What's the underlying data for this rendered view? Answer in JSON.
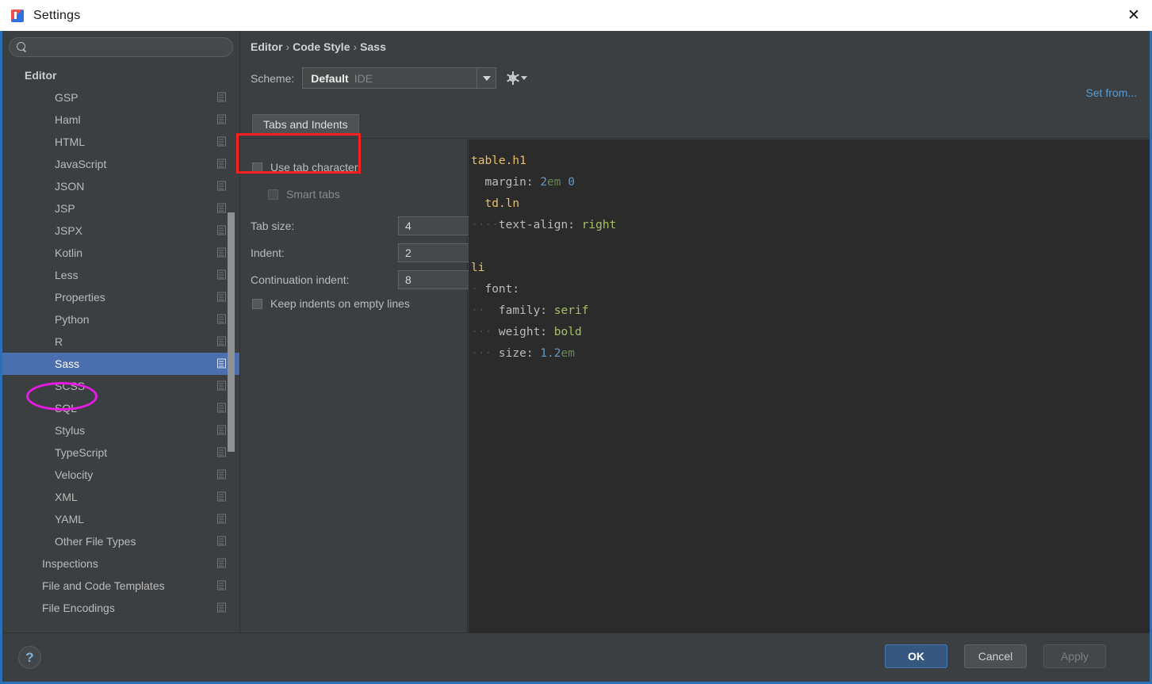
{
  "window": {
    "title": "Settings",
    "app_icon": "intellij-idea-icon",
    "close_label": "✕",
    "accent_border": "#2c6fb5"
  },
  "sidebar": {
    "search": {
      "value": "",
      "placeholder": "",
      "icon": "search-icon"
    },
    "items": [
      {
        "label": "Editor",
        "level": 0,
        "selected": false,
        "icon": false
      },
      {
        "label": "GSP",
        "level": 1,
        "selected": false,
        "icon": true
      },
      {
        "label": "Haml",
        "level": 1,
        "selected": false,
        "icon": true
      },
      {
        "label": "HTML",
        "level": 1,
        "selected": false,
        "icon": true
      },
      {
        "label": "JavaScript",
        "level": 1,
        "selected": false,
        "icon": true
      },
      {
        "label": "JSON",
        "level": 1,
        "selected": false,
        "icon": true
      },
      {
        "label": "JSP",
        "level": 1,
        "selected": false,
        "icon": true
      },
      {
        "label": "JSPX",
        "level": 1,
        "selected": false,
        "icon": true
      },
      {
        "label": "Kotlin",
        "level": 1,
        "selected": false,
        "icon": true
      },
      {
        "label": "Less",
        "level": 1,
        "selected": false,
        "icon": true
      },
      {
        "label": "Properties",
        "level": 1,
        "selected": false,
        "icon": true
      },
      {
        "label": "Python",
        "level": 1,
        "selected": false,
        "icon": true
      },
      {
        "label": "R",
        "level": 1,
        "selected": false,
        "icon": true
      },
      {
        "label": "Sass",
        "level": 1,
        "selected": true,
        "icon": true
      },
      {
        "label": "SCSS",
        "level": 1,
        "selected": false,
        "icon": true
      },
      {
        "label": "SQL",
        "level": 1,
        "selected": false,
        "icon": true
      },
      {
        "label": "Stylus",
        "level": 1,
        "selected": false,
        "icon": true
      },
      {
        "label": "TypeScript",
        "level": 1,
        "selected": false,
        "icon": true
      },
      {
        "label": "Velocity",
        "level": 1,
        "selected": false,
        "icon": true
      },
      {
        "label": "XML",
        "level": 1,
        "selected": false,
        "icon": true
      },
      {
        "label": "YAML",
        "level": 1,
        "selected": false,
        "icon": true
      },
      {
        "label": "Other File Types",
        "level": 1,
        "selected": false,
        "icon": true
      },
      {
        "label": "Inspections",
        "level": 5,
        "selected": false,
        "icon": true
      },
      {
        "label": "File and Code Templates",
        "level": 5,
        "selected": false,
        "icon": true
      },
      {
        "label": "File Encodings",
        "level": 5,
        "selected": false,
        "icon": true
      }
    ]
  },
  "content": {
    "breadcrumb": {
      "parts": [
        "Editor",
        "Code Style",
        "Sass"
      ],
      "separator": "›"
    },
    "scheme": {
      "label": "Scheme:",
      "value": "Default",
      "sub_value": "IDE",
      "dropdown_icon": "chevron-down-icon",
      "gear_icon": "gear-icon"
    },
    "set_from_link": "Set from...",
    "tabs": [
      {
        "label": "Tabs and Indents",
        "active": true
      }
    ],
    "options": {
      "use_tab_character": {
        "label": "Use tab character",
        "checked": false,
        "disabled": false
      },
      "smart_tabs": {
        "label": "Smart tabs",
        "checked": false,
        "disabled": true
      },
      "tab_size": {
        "label": "Tab size:",
        "value": "4"
      },
      "indent": {
        "label": "Indent:",
        "value": "2"
      },
      "continuation_indent": {
        "label": "Continuation indent:",
        "value": "8"
      },
      "keep_indents": {
        "label": "Keep indents on empty lines",
        "checked": false,
        "disabled": false
      }
    },
    "preview": {
      "lines": [
        [
          {
            "t": "table",
            "c": "c-sel"
          },
          {
            "t": ".h1",
            "c": "c-sel"
          }
        ],
        [
          {
            "t": "  ",
            "c": "c-dot"
          },
          {
            "t": "margin: ",
            "c": "c-prop"
          },
          {
            "t": "2",
            "c": "c-num"
          },
          {
            "t": "em ",
            "c": "c-unit"
          },
          {
            "t": "0",
            "c": "c-num"
          }
        ],
        [
          {
            "t": "  ",
            "c": "c-dot"
          },
          {
            "t": "td",
            "c": "c-sel"
          },
          {
            "t": ".ln",
            "c": "c-sel"
          }
        ],
        [
          {
            "t": "····",
            "c": "c-dot"
          },
          {
            "t": "text-align: ",
            "c": "c-prop"
          },
          {
            "t": "right",
            "c": "c-val"
          }
        ],
        [],
        [
          {
            "t": "li",
            "c": "c-sel"
          }
        ],
        [
          {
            "t": "·",
            "c": "c-dot"
          },
          {
            "t": " font:",
            "c": "c-prop"
          }
        ],
        [
          {
            "t": "··",
            "c": "c-dot"
          },
          {
            "t": "  family: ",
            "c": "c-prop"
          },
          {
            "t": "serif",
            "c": "c-val"
          }
        ],
        [
          {
            "t": "···",
            "c": "c-dot"
          },
          {
            "t": " weight: ",
            "c": "c-prop"
          },
          {
            "t": "bold",
            "c": "c-val"
          }
        ],
        [
          {
            "t": "···",
            "c": "c-dot"
          },
          {
            "t": " size: ",
            "c": "c-prop"
          },
          {
            "t": "1",
            "c": "c-num"
          },
          {
            "t": ".",
            "c": "c-num"
          },
          {
            "t": "2",
            "c": "c-num"
          },
          {
            "t": "em",
            "c": "c-unit"
          }
        ]
      ]
    }
  },
  "footer": {
    "help_label": "?",
    "ok_label": "OK",
    "cancel_label": "Cancel",
    "apply_label": "Apply"
  },
  "annotations": {
    "red_box_target": "Tabs and Indents",
    "red_box_color": "#fd1f1f",
    "magenta_ellipse_target": "Sass",
    "magenta_ellipse_color": "#e81ae8"
  }
}
